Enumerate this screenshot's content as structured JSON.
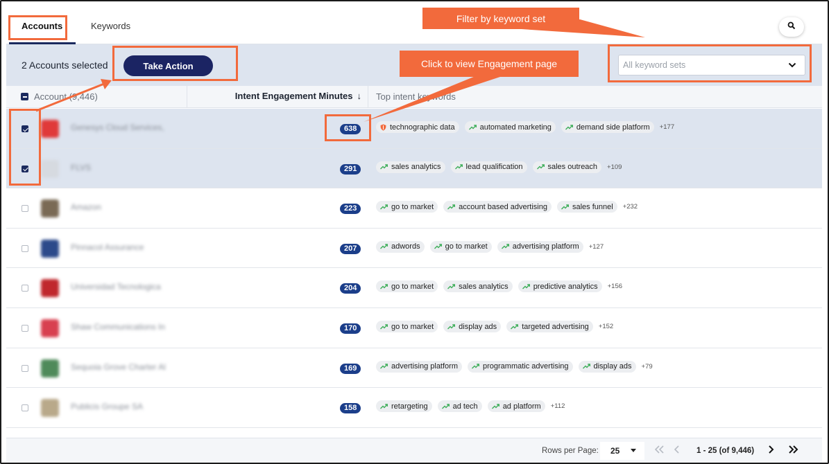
{
  "tabs": [
    {
      "label": "Accounts"
    },
    {
      "label": "Keywords"
    }
  ],
  "action_bar": {
    "selected_text": "2 Accounts selected",
    "take_action_label": "Take Action",
    "keyword_set_placeholder": "All keyword sets"
  },
  "table": {
    "col_account": "Account (9,446)",
    "col_intent": "Intent Engagement Minutes",
    "col_intent_sort": "↓",
    "col_keywords": "Top intent keywords"
  },
  "rows": [
    {
      "name": "Genesys Cloud Services,",
      "minutes": "638",
      "selected": true,
      "logo_color": "#e03a3a",
      "keywords": [
        {
          "label": "technographic data",
          "icon": "shield-icon"
        },
        {
          "label": "automated marketing",
          "icon": "trend-icon"
        },
        {
          "label": "demand side platform",
          "icon": "trend-icon"
        }
      ],
      "more": "+177"
    },
    {
      "name": "FLVS",
      "minutes": "291",
      "selected": true,
      "logo_color": "#d6dae0",
      "keywords": [
        {
          "label": "sales analytics",
          "icon": "trend-icon"
        },
        {
          "label": "lead qualification",
          "icon": "trend-icon"
        },
        {
          "label": "sales outreach",
          "icon": "trend-icon"
        }
      ],
      "more": "+109"
    },
    {
      "name": "Amazon",
      "minutes": "223",
      "selected": false,
      "logo_color": "#7a6a55",
      "keywords": [
        {
          "label": "go to market",
          "icon": "trend-icon"
        },
        {
          "label": "account based advertising",
          "icon": "trend-icon"
        },
        {
          "label": "sales funnel",
          "icon": "trend-icon"
        }
      ],
      "more": "+232"
    },
    {
      "name": "Pinnacol Assurance",
      "minutes": "207",
      "selected": false,
      "logo_color": "#2c4a8a",
      "keywords": [
        {
          "label": "adwords",
          "icon": "trend-icon"
        },
        {
          "label": "go to market",
          "icon": "trend-icon"
        },
        {
          "label": "advertising platform",
          "icon": "trend-icon"
        }
      ],
      "more": "+127"
    },
    {
      "name": "Universidad Tecnologica",
      "minutes": "204",
      "selected": false,
      "logo_color": "#c0282d",
      "keywords": [
        {
          "label": "go to market",
          "icon": "trend-icon"
        },
        {
          "label": "sales analytics",
          "icon": "trend-icon"
        },
        {
          "label": "predictive analytics",
          "icon": "trend-icon"
        }
      ],
      "more": "+156"
    },
    {
      "name": "Shaw Communications In",
      "minutes": "170",
      "selected": false,
      "logo_color": "#d84050",
      "keywords": [
        {
          "label": "go to market",
          "icon": "trend-icon"
        },
        {
          "label": "display ads",
          "icon": "trend-icon"
        },
        {
          "label": "targeted advertising",
          "icon": "trend-icon"
        }
      ],
      "more": "+152"
    },
    {
      "name": "Sequoia Grove Charter Al",
      "minutes": "169",
      "selected": false,
      "logo_color": "#4f8a5a",
      "keywords": [
        {
          "label": "advertising platform",
          "icon": "trend-icon"
        },
        {
          "label": "programmatic advertising",
          "icon": "trend-icon"
        },
        {
          "label": "display ads",
          "icon": "trend-icon"
        }
      ],
      "more": "+79"
    },
    {
      "name": "Publicis Groupe SA",
      "minutes": "158",
      "selected": false,
      "logo_color": "#b9a98a",
      "keywords": [
        {
          "label": "retargeting",
          "icon": "trend-icon"
        },
        {
          "label": "ad tech",
          "icon": "trend-icon"
        },
        {
          "label": "ad platform",
          "icon": "trend-icon"
        }
      ],
      "more": "+112"
    }
  ],
  "footer": {
    "rows_per_page_label": "Rows per Page:",
    "rows_per_page_value": "25",
    "range_text": "1 - 25 (of 9,446)"
  },
  "annotations": {
    "filter_callout": "Filter by keyword set",
    "engagement_callout": "Click to view Engagement page"
  },
  "colors": {
    "annotation": "#f26a3c",
    "primary": "#1b2463",
    "badge": "#1b3e8a",
    "selected_row": "#dde4ef",
    "trend_icon": "#3fae5a",
    "shield_icon": "#f26a3c"
  }
}
